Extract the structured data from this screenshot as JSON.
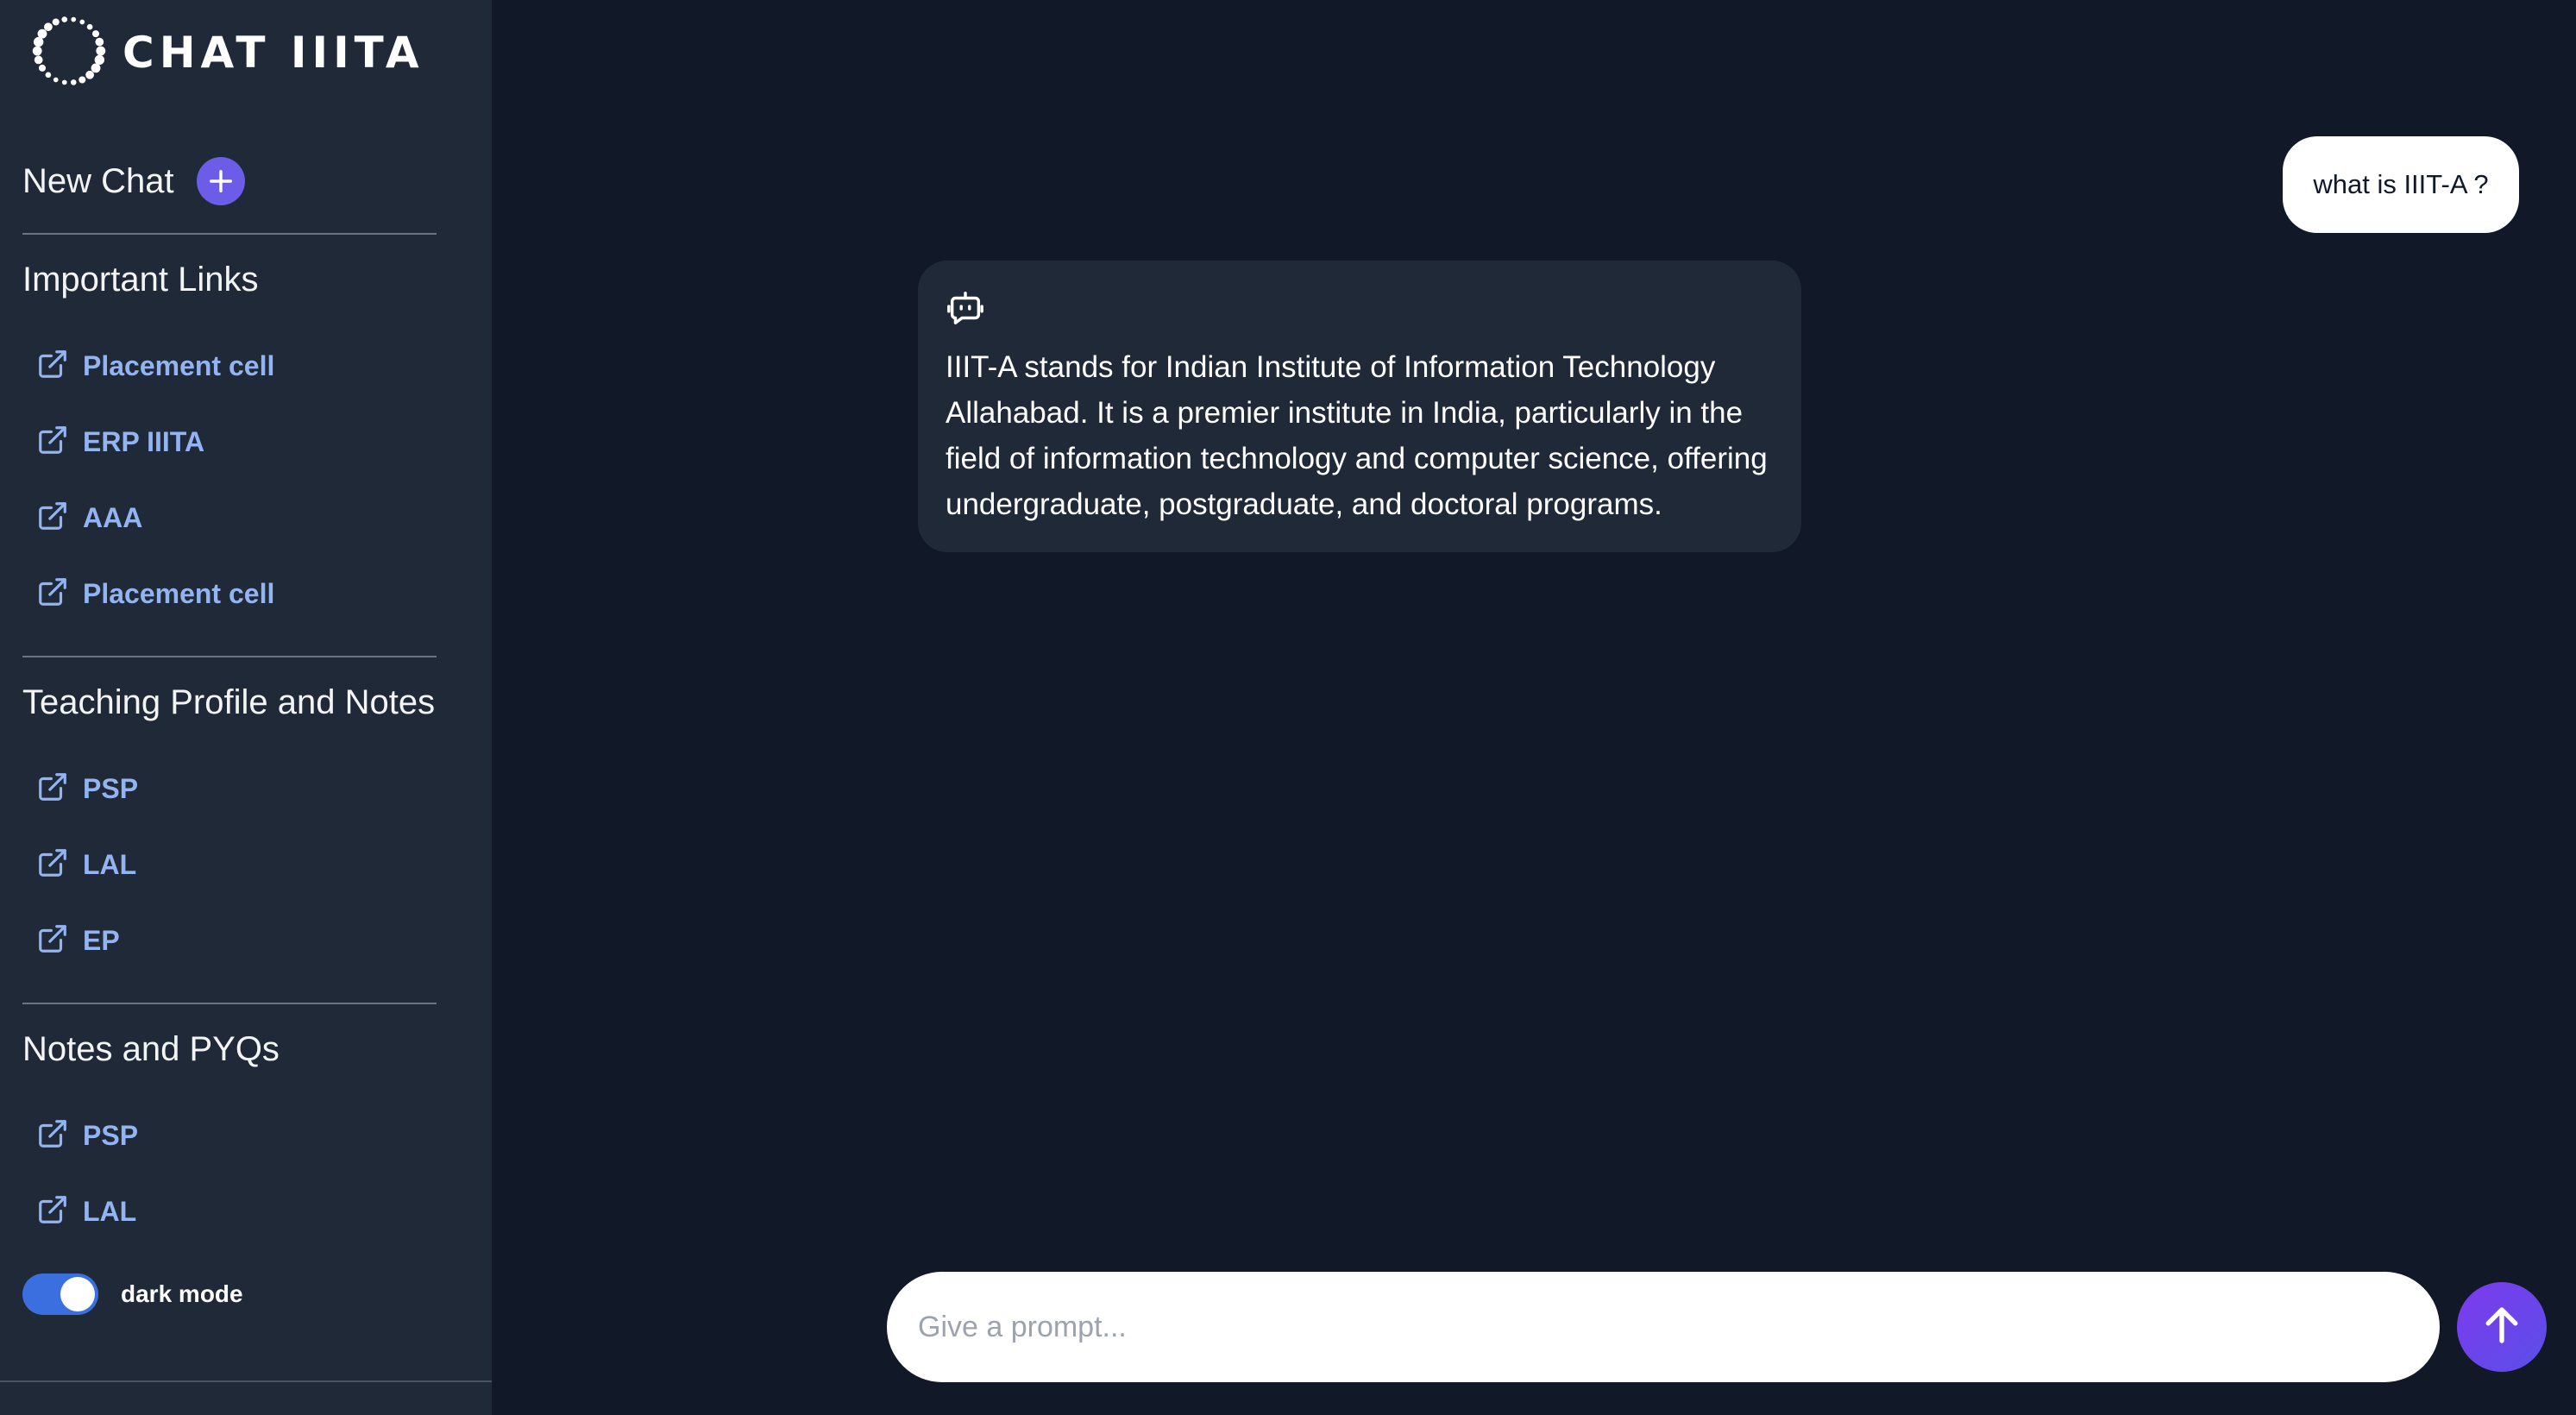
{
  "app": {
    "logo_text": "CHAT IIITA"
  },
  "sidebar": {
    "new_chat_label": "New Chat",
    "sections": [
      {
        "title": "Important Links",
        "links": [
          {
            "label": "Placement cell"
          },
          {
            "label": "ERP IIITA"
          },
          {
            "label": "AAA"
          },
          {
            "label": "Placement cell"
          }
        ]
      },
      {
        "title": "Teaching Profile and Notes",
        "links": [
          {
            "label": "PSP"
          },
          {
            "label": "LAL"
          },
          {
            "label": "EP"
          }
        ]
      },
      {
        "title": "Notes and PYQs",
        "links": [
          {
            "label": "PSP"
          },
          {
            "label": "LAL"
          }
        ]
      }
    ],
    "dark_mode_label": "dark mode",
    "dark_mode_on": true
  },
  "chat": {
    "user_message": "what is IIIT-A ?",
    "bot_message": "IIIT-A stands for Indian Institute of Information Technology Allahabad. It is a premier institute in India, particularly in the field of information technology and computer science, offering undergraduate, postgraduate, and doctoral programs."
  },
  "prompt": {
    "placeholder": "Give a prompt...",
    "value": ""
  },
  "icons": {
    "logo": "dotted-circle-logo-icon",
    "new_chat": "plus-icon",
    "link": "external-link-icon",
    "bot": "robot-icon",
    "send": "arrow-up-icon"
  },
  "colors": {
    "background": "#111827",
    "sidebar": "#1f2937",
    "accent": "#6d5ce8",
    "link": "#93b4f0",
    "toggle": "#3b6fe0"
  }
}
